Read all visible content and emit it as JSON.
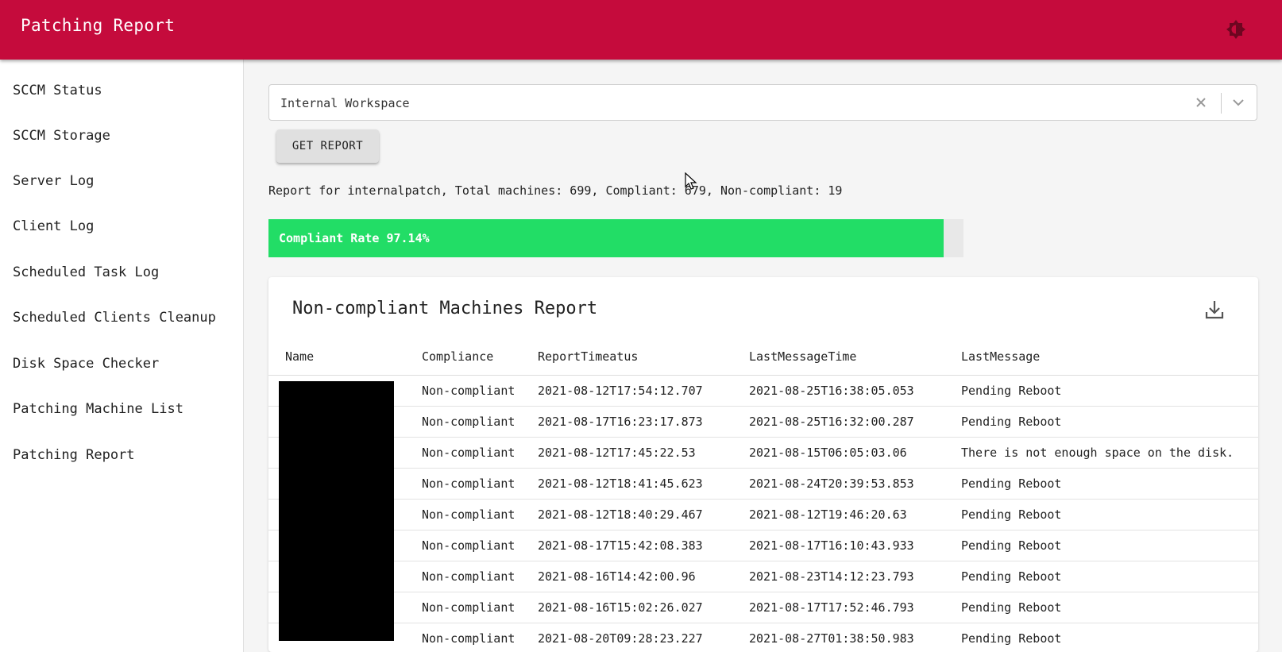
{
  "appbar": {
    "title": "Patching Report",
    "theme_icon": "brightness-icon"
  },
  "sidebar": {
    "items": [
      {
        "label": "SCCM Status"
      },
      {
        "label": "SCCM Storage"
      },
      {
        "label": "Server Log"
      },
      {
        "label": "Client Log"
      },
      {
        "label": "Scheduled Task Log"
      },
      {
        "label": "Scheduled Clients Cleanup"
      },
      {
        "label": "Disk Space Checker"
      },
      {
        "label": "Patching Machine List"
      },
      {
        "label": "Patching Report"
      }
    ]
  },
  "workspace_select": {
    "value": "Internal Workspace"
  },
  "get_report_button": {
    "label": "GET REPORT"
  },
  "summary": {
    "text": "Report for internalpatch, Total machines: 699, Compliant: 679, Non-compliant: 19"
  },
  "progress": {
    "label": "Compliant Rate 97.14%",
    "percent": 97.14,
    "color": "#22dd66"
  },
  "report": {
    "title": "Non-compliant Machines Report",
    "columns": [
      "Name",
      "Compliance",
      "ReportTimeatus",
      "LastMessageTime",
      "LastMessage"
    ],
    "rows": [
      {
        "name": "",
        "compliance": "Non-compliant",
        "report_time": "2021-08-12T17:54:12.707",
        "last_message_time": "2021-08-25T16:38:05.053",
        "last_message": "Pending Reboot"
      },
      {
        "name": "",
        "compliance": "Non-compliant",
        "report_time": "2021-08-17T16:23:17.873",
        "last_message_time": "2021-08-25T16:32:00.287",
        "last_message": "Pending Reboot"
      },
      {
        "name": "",
        "compliance": "Non-compliant",
        "report_time": "2021-08-12T17:45:22.53",
        "last_message_time": "2021-08-15T06:05:03.06",
        "last_message": "There is not enough space on the disk."
      },
      {
        "name": "",
        "compliance": "Non-compliant",
        "report_time": "2021-08-12T18:41:45.623",
        "last_message_time": "2021-08-24T20:39:53.853",
        "last_message": "Pending Reboot"
      },
      {
        "name": "",
        "compliance": "Non-compliant",
        "report_time": "2021-08-12T18:40:29.467",
        "last_message_time": "2021-08-12T19:46:20.63",
        "last_message": "Pending Reboot"
      },
      {
        "name": "",
        "compliance": "Non-compliant",
        "report_time": "2021-08-17T15:42:08.383",
        "last_message_time": "2021-08-17T16:10:43.933",
        "last_message": "Pending Reboot"
      },
      {
        "name": "",
        "compliance": "Non-compliant",
        "report_time": "2021-08-16T14:42:00.96",
        "last_message_time": "2021-08-23T14:12:23.793",
        "last_message": "Pending Reboot"
      },
      {
        "name": "",
        "compliance": "Non-compliant",
        "report_time": "2021-08-16T15:02:26.027",
        "last_message_time": "2021-08-17T17:52:46.793",
        "last_message": "Pending Reboot"
      },
      {
        "name": "",
        "compliance": "Non-compliant",
        "report_time": "2021-08-20T09:28:23.227",
        "last_message_time": "2021-08-27T01:38:50.983",
        "last_message": "Pending Reboot"
      }
    ]
  },
  "colors": {
    "appbar": "#c50b3c",
    "accent_green": "#22dd66"
  }
}
